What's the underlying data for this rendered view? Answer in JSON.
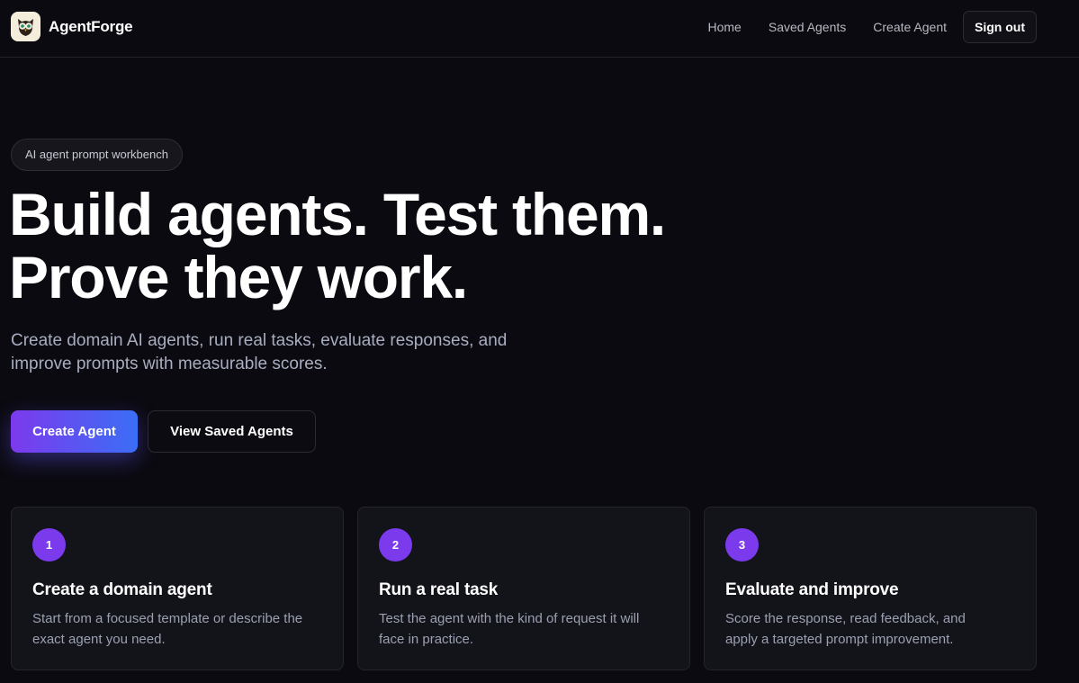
{
  "header": {
    "brand": "AgentForge",
    "logo_icon": "owl-icon",
    "nav": [
      "Home",
      "Saved Agents",
      "Create Agent"
    ],
    "signout": "Sign out"
  },
  "hero": {
    "badge": "AI agent prompt workbench",
    "title_lines": [
      "Build agents. Test them.",
      "Prove they work."
    ],
    "subtitle_lines": [
      "Create domain AI agents, run real tasks, evaluate responses, and",
      "improve prompts with measurable scores."
    ],
    "primary_button": "Create Agent",
    "secondary_button": "View Saved Agents"
  },
  "cards": [
    {
      "number": "1",
      "title": "Create a domain agent",
      "text_lines": [
        "Start from a focused template or describe the",
        "exact agent you need."
      ]
    },
    {
      "number": "2",
      "title": "Run a real task",
      "text_lines": [
        "Test the agent with the kind of request it will",
        "face in practice."
      ]
    },
    {
      "number": "3",
      "title": "Evaluate and improve",
      "text_lines": [
        "Score the response, read feedback, and",
        "apply a targeted prompt improvement."
      ]
    }
  ],
  "colors": {
    "background": "#0b0a10",
    "accent_purple": "#7c3aed",
    "accent_blue": "#3b6ef6",
    "card_background": "#13131a"
  }
}
